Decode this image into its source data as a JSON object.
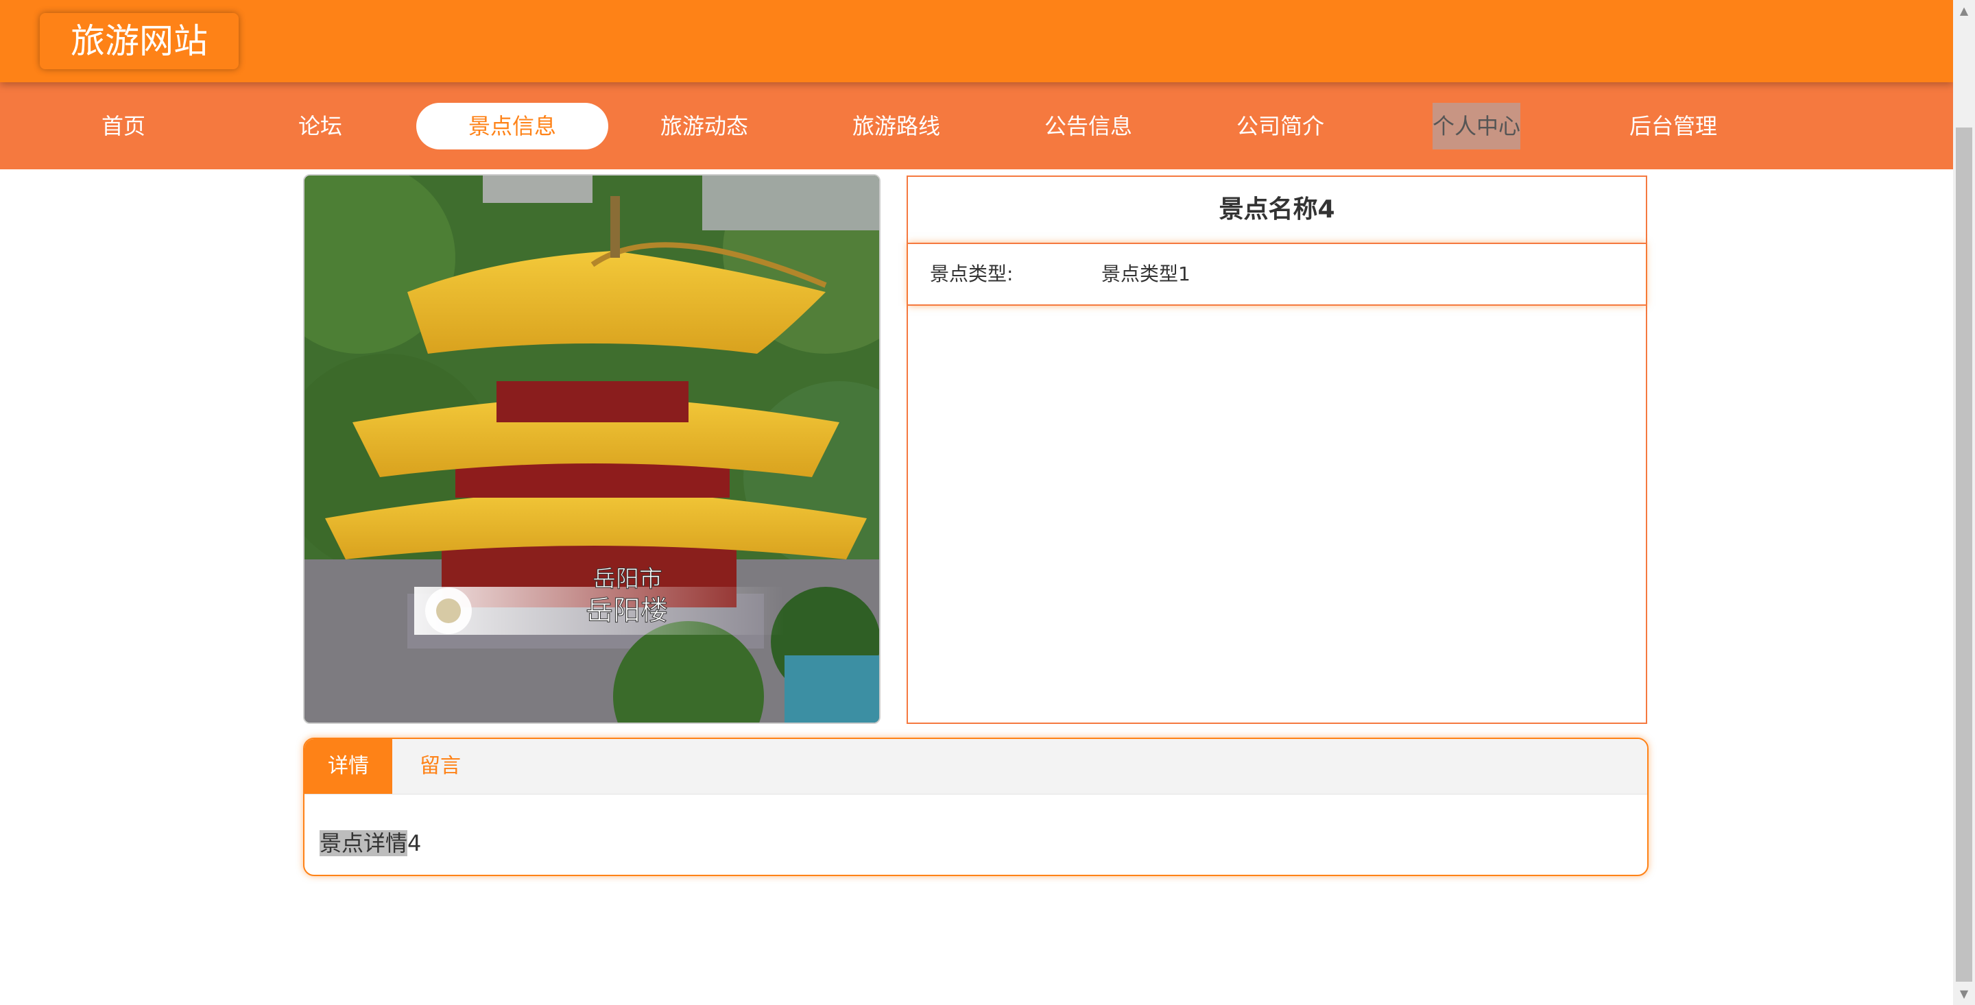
{
  "header": {
    "logo": "旅游网站"
  },
  "nav": [
    {
      "label": "首页"
    },
    {
      "label": "论坛"
    },
    {
      "label": "景点信息"
    },
    {
      "label": "旅游动态"
    },
    {
      "label": "旅游路线"
    },
    {
      "label": "公告信息"
    },
    {
      "label": "公司简介"
    },
    {
      "label": "个人中心"
    },
    {
      "label": "后台管理"
    }
  ],
  "spot": {
    "name": "景点名称4",
    "type_label": "景点类型:",
    "type_value": "景点类型1",
    "image_caption_line1": "岳阳市",
    "image_caption_line2": "岳阳楼"
  },
  "tabs": [
    {
      "label": "详情"
    },
    {
      "label": "留言"
    }
  ],
  "detail": {
    "text_selected": "景点详情",
    "text_rest": "4"
  },
  "colors": {
    "primary": "#fe8217",
    "nav_bg": "#f5793f",
    "accent_border": "#f5793f"
  }
}
